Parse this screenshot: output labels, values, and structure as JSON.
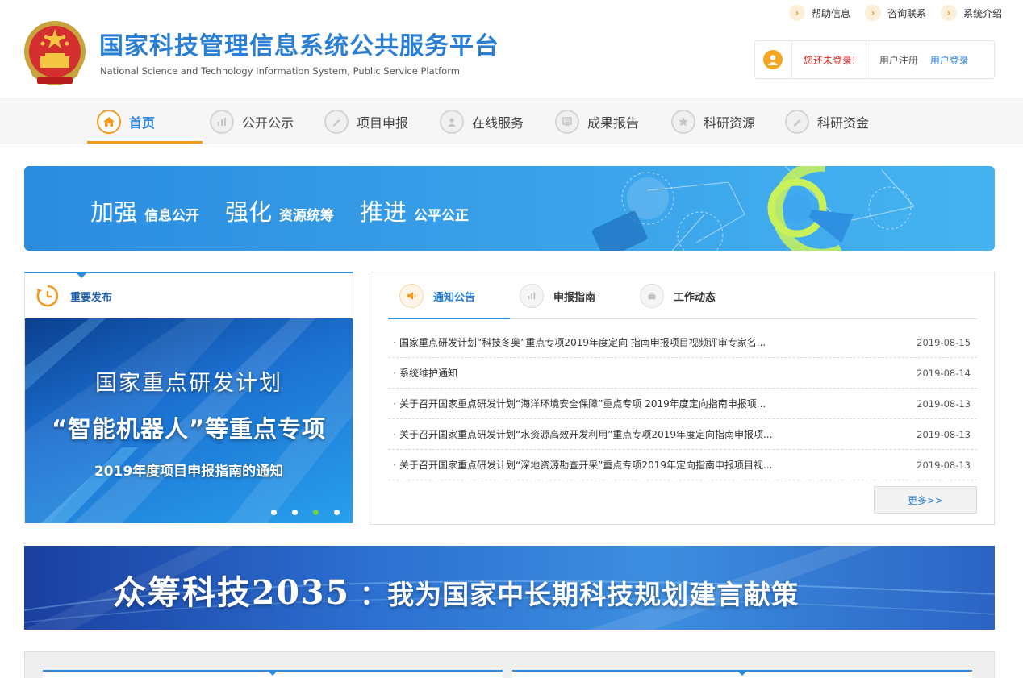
{
  "header": {
    "title": "国家科技管理信息系统公共服务平台",
    "subtitle": "National Science and Technology Information System, Public Service Platform",
    "top_links": [
      "帮助信息",
      "咨询联系",
      "系统介绍"
    ],
    "login_status": "您还未登录!",
    "register_label": "用户注册",
    "login_label": "用户登录"
  },
  "nav": {
    "items": [
      {
        "label": "首页",
        "icon": "home-icon",
        "active": true
      },
      {
        "label": "公开公示",
        "icon": "bar-chart-icon",
        "active": false
      },
      {
        "label": "项目申报",
        "icon": "pencil-icon",
        "active": false
      },
      {
        "label": "在线服务",
        "icon": "user-service-icon",
        "active": false
      },
      {
        "label": "成果报告",
        "icon": "report-icon",
        "active": false
      },
      {
        "label": "科研资源",
        "icon": "star-icon",
        "active": false
      },
      {
        "label": "科研资金",
        "icon": "pencil-icon",
        "active": false
      }
    ]
  },
  "banner1": {
    "parts": [
      {
        "big": "加强",
        "small": "信息公开"
      },
      {
        "big": "强化",
        "small": "资源统筹"
      },
      {
        "big": "推进",
        "small": "公平公正"
      }
    ]
  },
  "release": {
    "title": "重要发布",
    "slide": {
      "line1": "国家重点研发计划",
      "line2": "“智能机器人”等重点专项",
      "line3": "2019年度项目申报指南的通知"
    },
    "active_dot": 3
  },
  "notices": {
    "tabs": [
      {
        "label": "通知公告",
        "icon": "speaker-icon",
        "active": true
      },
      {
        "label": "申报指南",
        "icon": "bar-chart-icon",
        "active": false
      },
      {
        "label": "工作动态",
        "icon": "briefcase-icon",
        "active": false
      }
    ],
    "items": [
      {
        "title": "国家重点研发计划“科技冬奥”重点专项2019年度定向 指南申报项目视频评审专家名...",
        "date": "2019-08-15"
      },
      {
        "title": "系统维护通知",
        "date": "2019-08-14"
      },
      {
        "title": "关于召开国家重点研发计划“海洋环境安全保障”重点专项 2019年度定向指南申报项...",
        "date": "2019-08-13"
      },
      {
        "title": "关于召开国家重点研发计划“水资源高效开发利用”重点专项2019年度定向指南申报项...",
        "date": "2019-08-13"
      },
      {
        "title": "关于召开国家重点研发计划“深地资源勘查开采”重点专项2019年定向指南申报项目视...",
        "date": "2019-08-13"
      }
    ],
    "more_label": "更多>>"
  },
  "banner2": {
    "part1": "众筹科技2035",
    "part2": "：我为国家中长期科技规划建言献策"
  },
  "colors": {
    "brand_blue": "#2a7fd4",
    "accent_orange": "#f39a1e",
    "alert_red": "#e02020"
  }
}
